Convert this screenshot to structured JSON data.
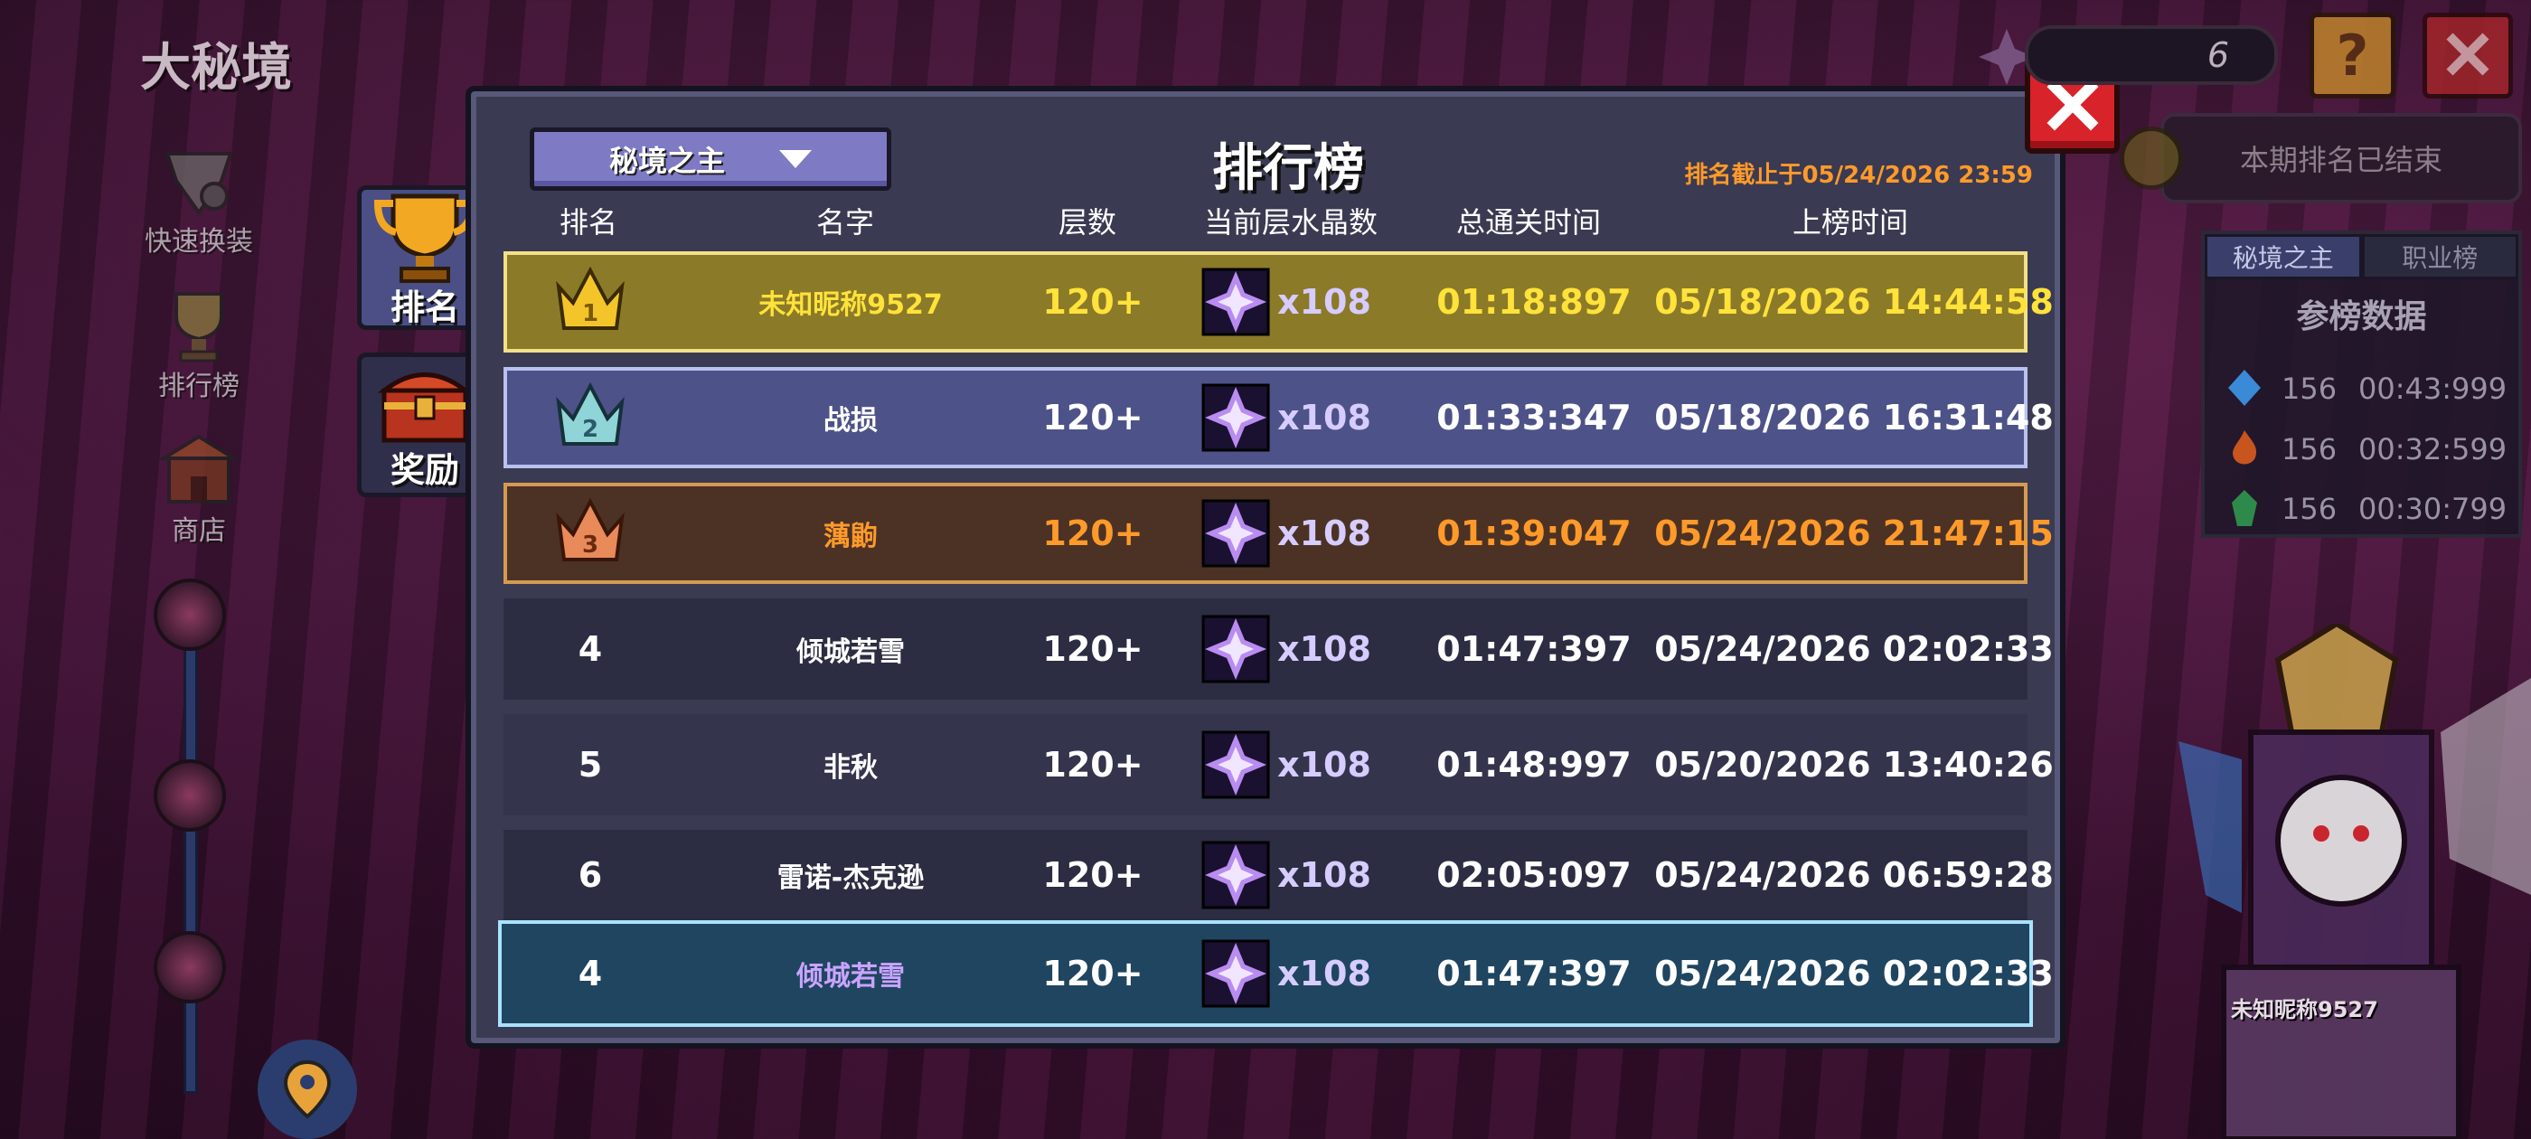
{
  "page_title": "大秘境",
  "side_nav": [
    {
      "label": "快速换装",
      "icon": "gear-swap-icon"
    },
    {
      "label": "排行榜",
      "icon": "trophy-icon"
    },
    {
      "label": "商店",
      "icon": "shop-icon"
    }
  ],
  "panel_tabs": [
    {
      "label": "排名",
      "icon": "trophy-icon",
      "active": true
    },
    {
      "label": "奖励",
      "icon": "chest-icon",
      "active": false
    }
  ],
  "leaderboard": {
    "dropdown_selected": "秘境之主",
    "title": "排行榜",
    "deadline": "排名截止于05/24/2026 23:59",
    "columns": [
      "排名",
      "名字",
      "层数",
      "当前层水晶数",
      "总通关时间",
      "上榜时间"
    ],
    "rows": [
      {
        "rank": "1",
        "name": "未知昵称9527",
        "floors": "120+",
        "crystals": "x108",
        "total_time": "01:18:897",
        "listed_time": "05/18/2026 14:44:58",
        "style": "gold"
      },
      {
        "rank": "2",
        "name": "战损",
        "floors": "120+",
        "crystals": "x108",
        "total_time": "01:33:347",
        "listed_time": "05/18/2026 16:31:48",
        "style": "silver"
      },
      {
        "rank": "3",
        "name": "蕅鼩",
        "floors": "120+",
        "crystals": "x108",
        "total_time": "01:39:047",
        "listed_time": "05/24/2026 21:47:15",
        "style": "bronze"
      },
      {
        "rank": "4",
        "name": "倾城若雪",
        "floors": "120+",
        "crystals": "x108",
        "total_time": "01:47:397",
        "listed_time": "05/24/2026 02:02:33",
        "style": "plain"
      },
      {
        "rank": "5",
        "name": "非秋",
        "floors": "120+",
        "crystals": "x108",
        "total_time": "01:48:997",
        "listed_time": "05/20/2026 13:40:26",
        "style": "plain"
      },
      {
        "rank": "6",
        "name": "雷诺-杰克逊",
        "floors": "120+",
        "crystals": "x108",
        "total_time": "02:05:097",
        "listed_time": "05/24/2026 06:59:28",
        "style": "plain"
      }
    ],
    "my_row": {
      "rank": "4",
      "name": "倾城若雪",
      "floors": "120+",
      "crystals": "x108",
      "total_time": "01:47:397",
      "listed_time": "05/24/2026 02:02:33"
    }
  },
  "hud": {
    "currency_count": "6",
    "help_label": "?",
    "ended_status": "本期排名已结束"
  },
  "stats": {
    "tabs": [
      "秘境之主",
      "职业榜"
    ],
    "active_tab": "秘境之主",
    "heading": "参榜数据",
    "entries": [
      {
        "icon": "blue-crystal-icon",
        "count": "156",
        "time": "00:43:999"
      },
      {
        "icon": "fire-crystal-icon",
        "count": "156",
        "time": "00:32:599"
      },
      {
        "icon": "green-crystal-icon",
        "count": "156",
        "time": "00:30:799"
      }
    ]
  },
  "boss_name": "未知昵称9527",
  "colors": {
    "gold_text": "#ffe23a",
    "bronze_text": "#ff9a2a",
    "close_red": "#d9232a",
    "dropdown_purple": "#7e7ac4"
  }
}
